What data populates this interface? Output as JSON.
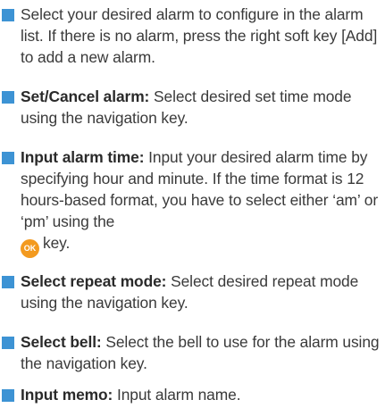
{
  "items": [
    {
      "label": "",
      "text": "Select your desired alarm to configure in the alarm list. If there is no alarm, press the right soft key [Add] to add a new alarm."
    },
    {
      "label": "Set/Cancel alarm:",
      "text": " Select desired set time mode using the navigation key."
    },
    {
      "label": "Input alarm time:",
      "text": " Input your desired alarm time by specifying hour and minute. If the time format is 12 hours-based format, you have to select either ‘am’ or ‘pm’ using the",
      "key_glyph": "OK",
      "text_after_key": "key."
    },
    {
      "label": "Select repeat mode:",
      "text": " Select desired repeat mode using the navigation key."
    },
    {
      "label": "Select bell:",
      "text": " Select the bell to use for the alarm using the navigation key."
    },
    {
      "label": "Input memo:",
      "text": " Input alarm name."
    }
  ],
  "colors": {
    "bullet": "#3d93d4",
    "ok_key": "#f39a1f",
    "text": "#3a3a3a"
  }
}
